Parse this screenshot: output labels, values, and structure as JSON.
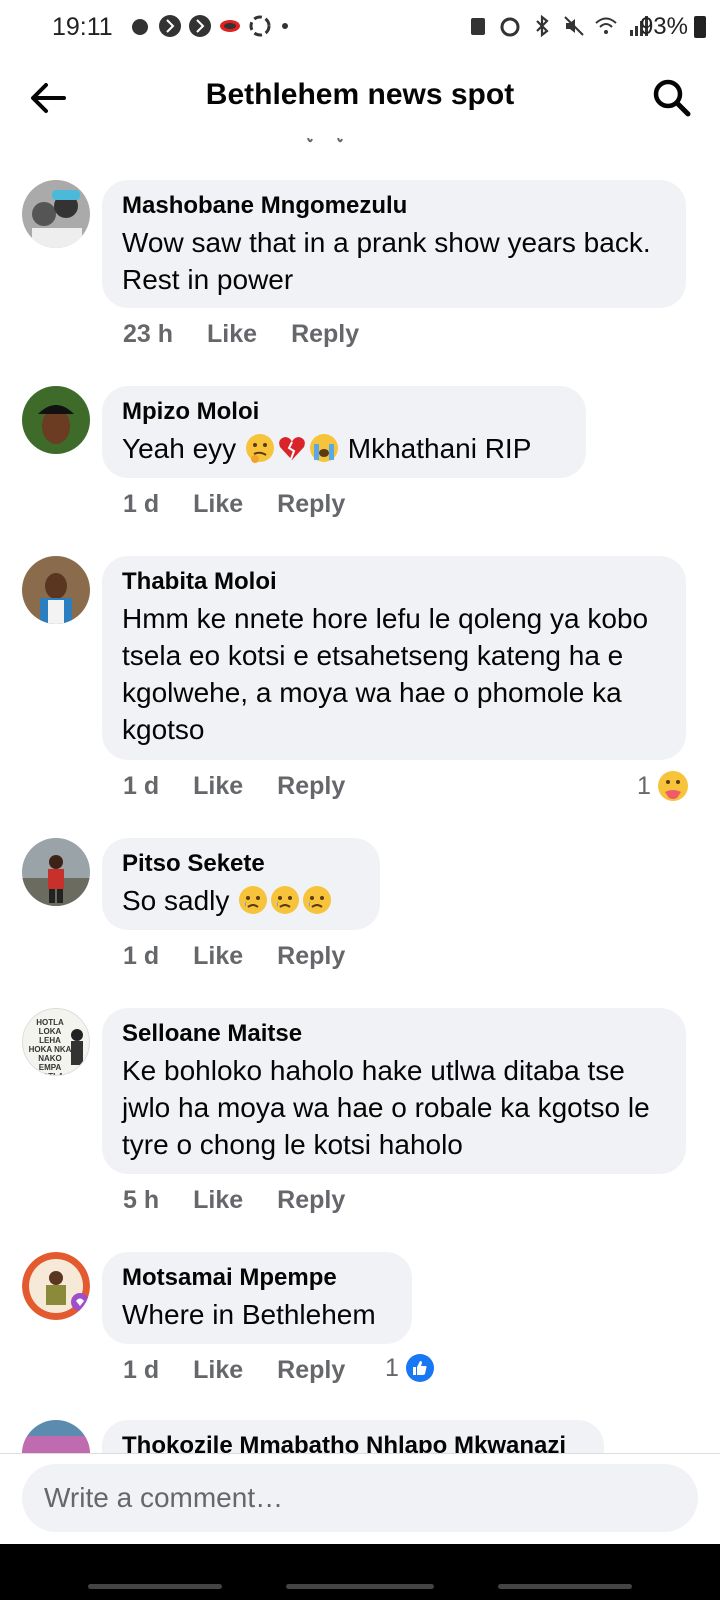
{
  "status_bar": {
    "time": "19:11",
    "battery": "93%"
  },
  "header": {
    "title": "Bethlehem news spot"
  },
  "comments": [
    {
      "author": "Mashobane Mngomezulu",
      "text": "Wow saw that in a prank show years back. Rest in power",
      "time": "23 h",
      "like": "Like",
      "reply": "Reply"
    },
    {
      "author": "Mpizo Moloi",
      "text_before": "Yeah eyy",
      "text_after": "Mkhathani RIP",
      "time": "1 d",
      "like": "Like",
      "reply": "Reply"
    },
    {
      "author": "Thabita Moloi",
      "text": "Hmm ke nnete hore lefu le qoleng ya kobo tsela eo kotsi e etsahetseng kateng ha e kgolwehe, a moya wa hae o phomole ka kgotso",
      "time": "1 d",
      "like": "Like",
      "reply": "Reply",
      "reaction_count": "1"
    },
    {
      "author": "Pitso Sekete",
      "text_before": "So sadly",
      "time": "1 d",
      "like": "Like",
      "reply": "Reply"
    },
    {
      "author": "Selloane Maitse",
      "text": "Ke bohloko haholo hake utlwa ditaba tse jwlo ha moya wa hae o robale ka kgotso le tyre o chong le kotsi haholo",
      "time": "5 h",
      "like": "Like",
      "reply": "Reply",
      "avatar_text": "HOTLA LOKA LEHA HOKA NKA NAKO EMPA HOTLA LOKA"
    },
    {
      "author": "Motsamai Mpempe",
      "text": "Where in Bethlehem",
      "time": "1 d",
      "like": "Like",
      "reply": "Reply",
      "reaction_count": "1"
    },
    {
      "author": "Thokozile Mmabatho Nhlapo Mkwanazi"
    }
  ],
  "composer": {
    "placeholder": "Write a comment…"
  },
  "colors": {
    "bubble": "#f0f2f5",
    "meta": "#65676b",
    "like_blue": "#1877f2"
  }
}
